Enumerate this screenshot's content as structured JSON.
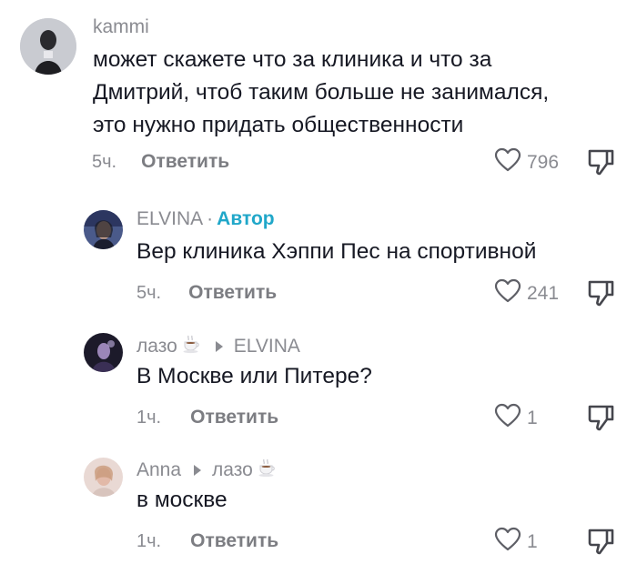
{
  "comments": [
    {
      "username": "kammi",
      "text": "может скажете что за клиника и что за Дмитрий, чтоб таким больше не занимался, это нужно придать общественности",
      "time": "5ч.",
      "reply_label": "Ответить",
      "likes": "796"
    },
    {
      "username": "ELVINA",
      "separator": "·",
      "author_label": "Автор",
      "text": "Вер клиника Хэппи Пес на спортивной",
      "time": "5ч.",
      "reply_label": "Ответить",
      "likes": "241"
    },
    {
      "username": "лазо",
      "reply_to": "ELVINA",
      "text": "В Москве или Питере?",
      "time": "1ч.",
      "reply_label": "Ответить",
      "likes": "1"
    },
    {
      "username": "Anna",
      "reply_to": "лазо",
      "text": "в москве",
      "time": "1ч.",
      "reply_label": "Ответить",
      "likes": "1"
    }
  ],
  "colors": {
    "author_badge": "#20a7c9",
    "meta_text": "#8a8b91",
    "body_text": "#161823"
  }
}
